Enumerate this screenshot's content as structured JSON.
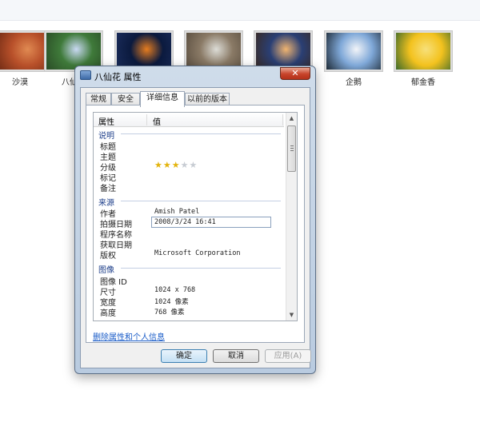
{
  "thumbnails": [
    {
      "label": "沙漠",
      "colors": [
        "#b8502a",
        "#e08a52",
        "#6e2a14"
      ]
    },
    {
      "label": "八仙花",
      "colors": [
        "#3f7a3a",
        "#c9d9f3",
        "#2a4c26"
      ]
    },
    {
      "label": "",
      "colors": [
        "#0b1a3e",
        "#e57c1f",
        "#1b2d5c"
      ]
    },
    {
      "label": "",
      "colors": [
        "#8a7a66",
        "#dcdcd6",
        "#5a4e40"
      ]
    },
    {
      "label": "",
      "colors": [
        "#2a3f74",
        "#f0b470",
        "#3a2a22"
      ]
    },
    {
      "label": "企鹅",
      "colors": [
        "#7fa8d8",
        "#f2f4f8",
        "#1e2a36"
      ]
    },
    {
      "label": "郁金香",
      "colors": [
        "#f3c21e",
        "#f7e07a",
        "#3d6a2a"
      ]
    }
  ],
  "dialog": {
    "title": "八仙花 属性",
    "close_label": "✕",
    "tabs": [
      "常规",
      "安全",
      "详细信息",
      "以前的版本"
    ],
    "active_tab": 2,
    "columns": {
      "property": "属性",
      "value": "值"
    },
    "groups": {
      "description": {
        "label": "说明",
        "rows": [
          {
            "label": "标题",
            "value": ""
          },
          {
            "label": "主题",
            "value": ""
          },
          {
            "label": "分级",
            "value": ""
          },
          {
            "label": "标记",
            "value": ""
          },
          {
            "label": "备注",
            "value": ""
          }
        ],
        "rating": {
          "filled": 3,
          "total": 5
        }
      },
      "origin": {
        "label": "来源",
        "rows": [
          {
            "label": "作者",
            "value": "Amish Patel"
          },
          {
            "label": "拍摄日期",
            "value": "2008/3/24 16:41"
          },
          {
            "label": "程序名称",
            "value": ""
          },
          {
            "label": "获取日期",
            "value": ""
          },
          {
            "label": "版权",
            "value": "Microsoft Corporation"
          }
        ]
      },
      "image": {
        "label": "图像",
        "rows": [
          {
            "label": "图像 ID",
            "value": ""
          },
          {
            "label": "尺寸",
            "value": "1024 x 768"
          },
          {
            "label": "宽度",
            "value": "1024 像素"
          },
          {
            "label": "高度",
            "value": "768 像素"
          }
        ]
      }
    },
    "remove_link": "删除属性和个人信息",
    "buttons": {
      "ok": "确定",
      "cancel": "取消",
      "apply": "应用(A)"
    }
  }
}
